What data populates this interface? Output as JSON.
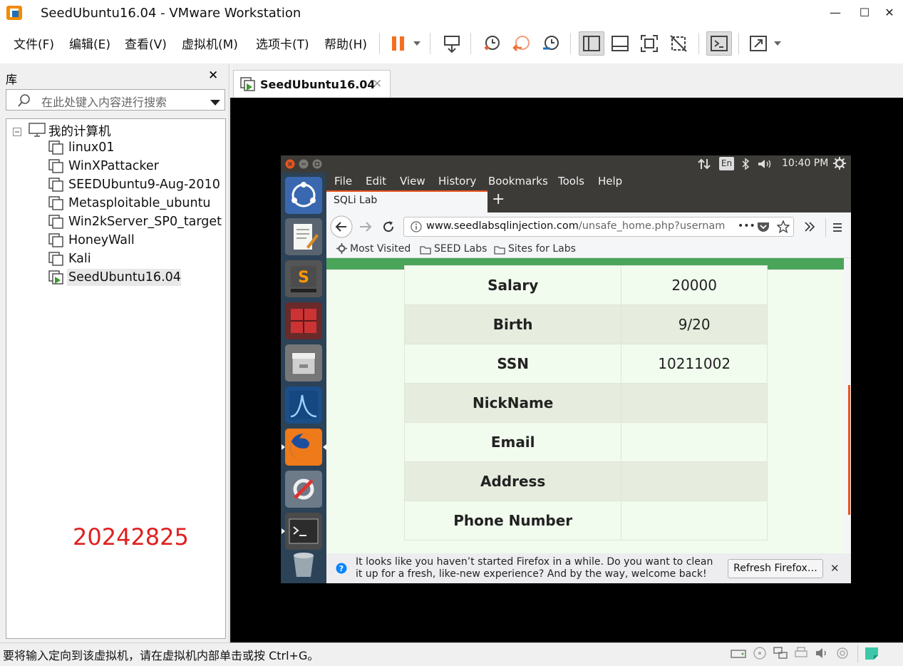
{
  "window": {
    "title": "SeedUbuntu16.04 - VMware Workstation",
    "minimize": "—",
    "maximize": "☐",
    "close": "✕"
  },
  "menu": [
    "文件(F)",
    "编辑(E)",
    "查看(V)",
    "虚拟机(M)",
    "选项卡(T)",
    "帮助(H)"
  ],
  "library": {
    "title": "库",
    "close": "✕",
    "search_placeholder": "在此处键入内容进行搜索",
    "root": "我的计算机",
    "vms": [
      "linux01",
      "WinXPattacker",
      "SEEDUbuntu9-Aug-2010",
      "Metasploitable_ubuntu",
      "Win2kServer_SP0_target",
      "HoneyWall",
      "Kali",
      "SeedUbuntu16.04"
    ],
    "selected": "SeedUbuntu16.04"
  },
  "watermark": "20242825",
  "vm_tab": {
    "label": "SeedUbuntu16.04",
    "close": "✕"
  },
  "guest": {
    "topbar": {
      "lang": "En",
      "time": "10:40 PM"
    },
    "firefox": {
      "menu": [
        "File",
        "Edit",
        "View",
        "History",
        "Bookmarks",
        "Tools",
        "Help"
      ],
      "tab": "SQLi Lab",
      "new_tab": "+",
      "url_host": "www.seedlabsqlinjection.com",
      "url_rest": "/unsafe_home.php?usernam",
      "url_more": "•••",
      "bookmarks": [
        "Most Visited",
        "SEED Labs",
        "Sites for Labs"
      ],
      "table": [
        {
          "key": "Salary",
          "value": "20000"
        },
        {
          "key": "Birth",
          "value": "9/20"
        },
        {
          "key": "SSN",
          "value": "10211002"
        },
        {
          "key": "NickName",
          "value": ""
        },
        {
          "key": "Email",
          "value": ""
        },
        {
          "key": "Address",
          "value": ""
        },
        {
          "key": "Phone Number",
          "value": ""
        }
      ],
      "notification": {
        "text": "It looks like you haven’t started Firefox in a while. Do you want to clean it up for a fresh, like-new experience? And by the way, welcome back!",
        "button": "Refresh Firefox…",
        "close": "✕"
      }
    }
  },
  "status": {
    "text": "要将输入定向到该虚拟机，请在虚拟机内部单击或按 Ctrl+G。"
  },
  "colors": {
    "accent_ubuntu": "#e95420",
    "green_bar": "#4aa45a",
    "watermark": "#e02020",
    "pause": "#f37021"
  }
}
